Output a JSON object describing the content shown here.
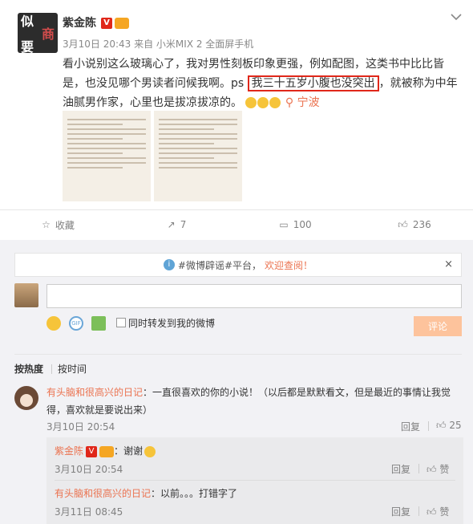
{
  "post": {
    "avatar_text": [
      "似",
      "商",
      "要",
      "醉",
      "犯",
      "罪"
    ],
    "author": "紫金陈",
    "meta": "3月10日 20:43 来自 小米MIX 2 全面屏手机",
    "text_before": "看小说别这么玻璃心了，我对男性刻板印象更强，例如配图，这类书中比比皆是，也没见哪个男读者问候我啊。ps ",
    "text_highlight": "我三十五岁小腹也没突出",
    "text_after": "，就被称为中年油腻男作家，心里也是拔凉拔凉的。",
    "location": "宁波",
    "emotion_icon": "sweat-emoji"
  },
  "actions": {
    "favorite_label": "收藏",
    "share_count": "7",
    "comment_count": "100",
    "like_count": "236"
  },
  "notice": {
    "text": "#微博辟谣#平台，",
    "link": "欢迎查阅！",
    "close": "×"
  },
  "composer": {
    "repost_label": "同时转发到我的微博",
    "submit_label": "评论"
  },
  "sort": {
    "hot": "按热度",
    "time": "按时间"
  },
  "comments": [
    {
      "user": "有头脑和很高兴的日记",
      "text": "：一直很喜欢的你的小说！（以后都是默默看文，但是最近的事情让我觉得，喜欢就是要说出来）",
      "time": "3月10日 20:54",
      "reply_label": "回复",
      "likes": "25"
    }
  ],
  "replies": [
    {
      "user": "紫金陈",
      "text": "：谢谢",
      "time": "3月10日 20:54",
      "reply_label": "回复",
      "like_label": "赞"
    },
    {
      "user": "有头脑和很高兴的日记",
      "text": "：以前。。。打错字了",
      "time": "3月11日 08:45",
      "reply_label": "回复",
      "like_label": "赞"
    }
  ],
  "colors": {
    "accent": "#eb7350",
    "vip_red": "#e0271a",
    "panel_bg": "#f2f2f5",
    "button_disabled": "#fdc39c"
  }
}
